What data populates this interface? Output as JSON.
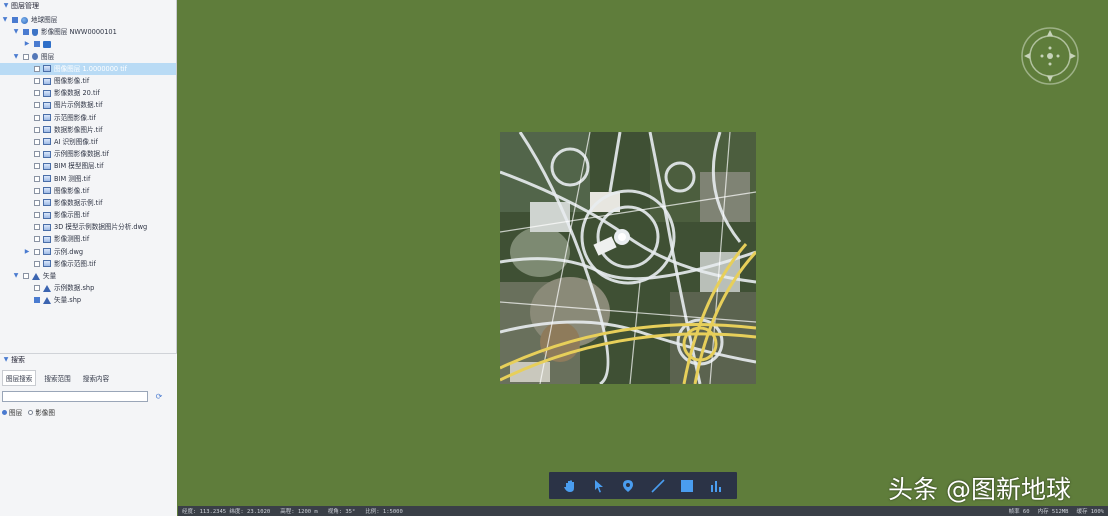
{
  "layer_panel": {
    "title": "图层管理",
    "tree": [
      {
        "indent": 0,
        "expand": "▼",
        "checked": true,
        "icon": "globe",
        "label": "地球图层"
      },
      {
        "indent": 1,
        "expand": "▼",
        "checked": true,
        "icon": "shield",
        "label": "影像图层 NWW0000101"
      },
      {
        "indent": 2,
        "expand": "▶",
        "checked": true,
        "icon": "folder",
        "label": ""
      },
      {
        "indent": 1,
        "expand": "▼",
        "checked": false,
        "icon": "group",
        "label": "图层"
      },
      {
        "indent": 2,
        "expand": "",
        "checked": false,
        "icon": "image",
        "label": "图像图层 1.0000000 tif",
        "selected": true
      },
      {
        "indent": 2,
        "expand": "",
        "checked": false,
        "icon": "image",
        "label": "图像影像.tif"
      },
      {
        "indent": 2,
        "expand": "",
        "checked": false,
        "icon": "image",
        "label": "影像数据 20.tif"
      },
      {
        "indent": 2,
        "expand": "",
        "checked": false,
        "icon": "image",
        "label": "图片示例数据.tif"
      },
      {
        "indent": 2,
        "expand": "",
        "checked": false,
        "icon": "image",
        "label": "示范图影像.tif"
      },
      {
        "indent": 2,
        "expand": "",
        "checked": false,
        "icon": "image",
        "label": "数据影像图片.tif"
      },
      {
        "indent": 2,
        "expand": "",
        "checked": false,
        "icon": "image",
        "label": "AI 识别图像.tif"
      },
      {
        "indent": 2,
        "expand": "",
        "checked": false,
        "icon": "image",
        "label": "示例图影像数据.tif"
      },
      {
        "indent": 2,
        "expand": "",
        "checked": false,
        "icon": "image",
        "label": "BIM 模型图层.tif"
      },
      {
        "indent": 2,
        "expand": "",
        "checked": false,
        "icon": "image",
        "label": "BIM 测图.tif"
      },
      {
        "indent": 2,
        "expand": "",
        "checked": false,
        "icon": "image",
        "label": "图像影像.tif"
      },
      {
        "indent": 2,
        "expand": "",
        "checked": false,
        "icon": "image",
        "label": "影像数据示例.tif"
      },
      {
        "indent": 2,
        "expand": "",
        "checked": false,
        "icon": "image",
        "label": "影像示图.tif"
      },
      {
        "indent": 2,
        "expand": "",
        "checked": false,
        "icon": "image",
        "label": "3D 模型示例数据图片分析.dwg"
      },
      {
        "indent": 2,
        "expand": "",
        "checked": false,
        "icon": "image",
        "label": "影像测图.tif"
      },
      {
        "indent": 2,
        "expand": "▶",
        "checked": false,
        "icon": "image",
        "label": "示例.dwg"
      },
      {
        "indent": 2,
        "expand": "",
        "checked": false,
        "icon": "image",
        "label": "影像示范图.tif"
      },
      {
        "indent": 1,
        "expand": "▼",
        "checked": false,
        "icon": "vector",
        "label": "矢量"
      },
      {
        "indent": 2,
        "expand": "",
        "checked": false,
        "icon": "vector",
        "label": "示例数据.shp"
      },
      {
        "indent": 2,
        "expand": "",
        "checked": true,
        "icon": "vector",
        "label": "矢量.shp"
      }
    ]
  },
  "search_panel": {
    "title": "搜索",
    "tabs": [
      "图层搜索",
      "搜索范围",
      "搜索内容"
    ],
    "input_value": "",
    "input_placeholder": "",
    "filters": [
      "图层",
      "影像图"
    ]
  },
  "map": {
    "background_color": "#5f7d3b",
    "toolbar_tools": [
      {
        "name": "hand-icon",
        "glyph": "✋"
      },
      {
        "name": "pointer-icon",
        "glyph": "➤"
      },
      {
        "name": "placemark-icon",
        "glyph": "⬤"
      },
      {
        "name": "line-icon",
        "glyph": "╱"
      },
      {
        "name": "polygon-icon",
        "glyph": "■"
      },
      {
        "name": "measure-icon",
        "glyph": "▮"
      }
    ]
  },
  "statusbar": {
    "left": [
      "经度: 113.2345 纬度: 23.1020",
      "高程: 1200 m",
      "视角: 35°",
      "比例: 1:5000"
    ],
    "right": [
      "帧率 60",
      "内存 512MB",
      "缓存 100%"
    ]
  },
  "watermark": "头条 @图新地球",
  "colors": {
    "accent": "#4a7bd0",
    "selection": "#b9dbf5",
    "toolbar": "#2b3346",
    "toolbar_icon": "#4a9df0"
  }
}
